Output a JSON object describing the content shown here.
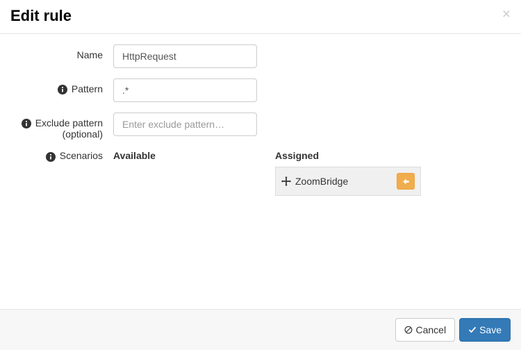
{
  "modal": {
    "title": "Edit rule"
  },
  "form": {
    "name": {
      "label": "Name",
      "value": "HttpRequest"
    },
    "pattern": {
      "label": "Pattern",
      "value": ".*"
    },
    "exclude": {
      "label": "Exclude pattern (optional)",
      "placeholder": "Enter exclude pattern…",
      "value": ""
    },
    "scenarios": {
      "label": "Scenarios",
      "available_heading": "Available",
      "assigned_heading": "Assigned",
      "assigned": [
        {
          "name": "ZoomBridge"
        }
      ]
    }
  },
  "footer": {
    "cancel": "Cancel",
    "save": "Save"
  }
}
